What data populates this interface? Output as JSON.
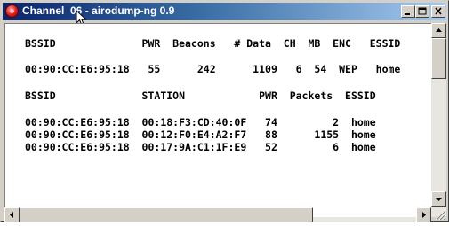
{
  "window": {
    "title": "Channel  06 - airodump-ng 0.9",
    "buttons": {
      "minimize": "_",
      "maximize": "□",
      "close": "×"
    }
  },
  "console": {
    "ap_header": "BSSID              PWR  Beacons   # Data  CH  MB  ENC   ESSID",
    "ap_rows": [
      "00:90:CC:E6:95:18   55      242      1109   6  54  WEP   home"
    ],
    "station_header": "BSSID              STATION            PWR  Packets  ESSID",
    "station_rows": [
      "00:90:CC:E6:95:18  00:18:F3:CD:40:0F   74         2  home",
      "00:90:CC:E6:95:18  00:12:F0:E4:A2:F7   88      1155  home",
      "00:90:CC:E6:95:18  00:17:9A:C1:1F:E9   52         6  home"
    ]
  },
  "colors": {
    "titlebar_start": "#0a246a",
    "titlebar_end": "#a6caf0",
    "window_face": "#d4d0c8",
    "console_bg": "#ffffff",
    "console_text": "#000000"
  }
}
